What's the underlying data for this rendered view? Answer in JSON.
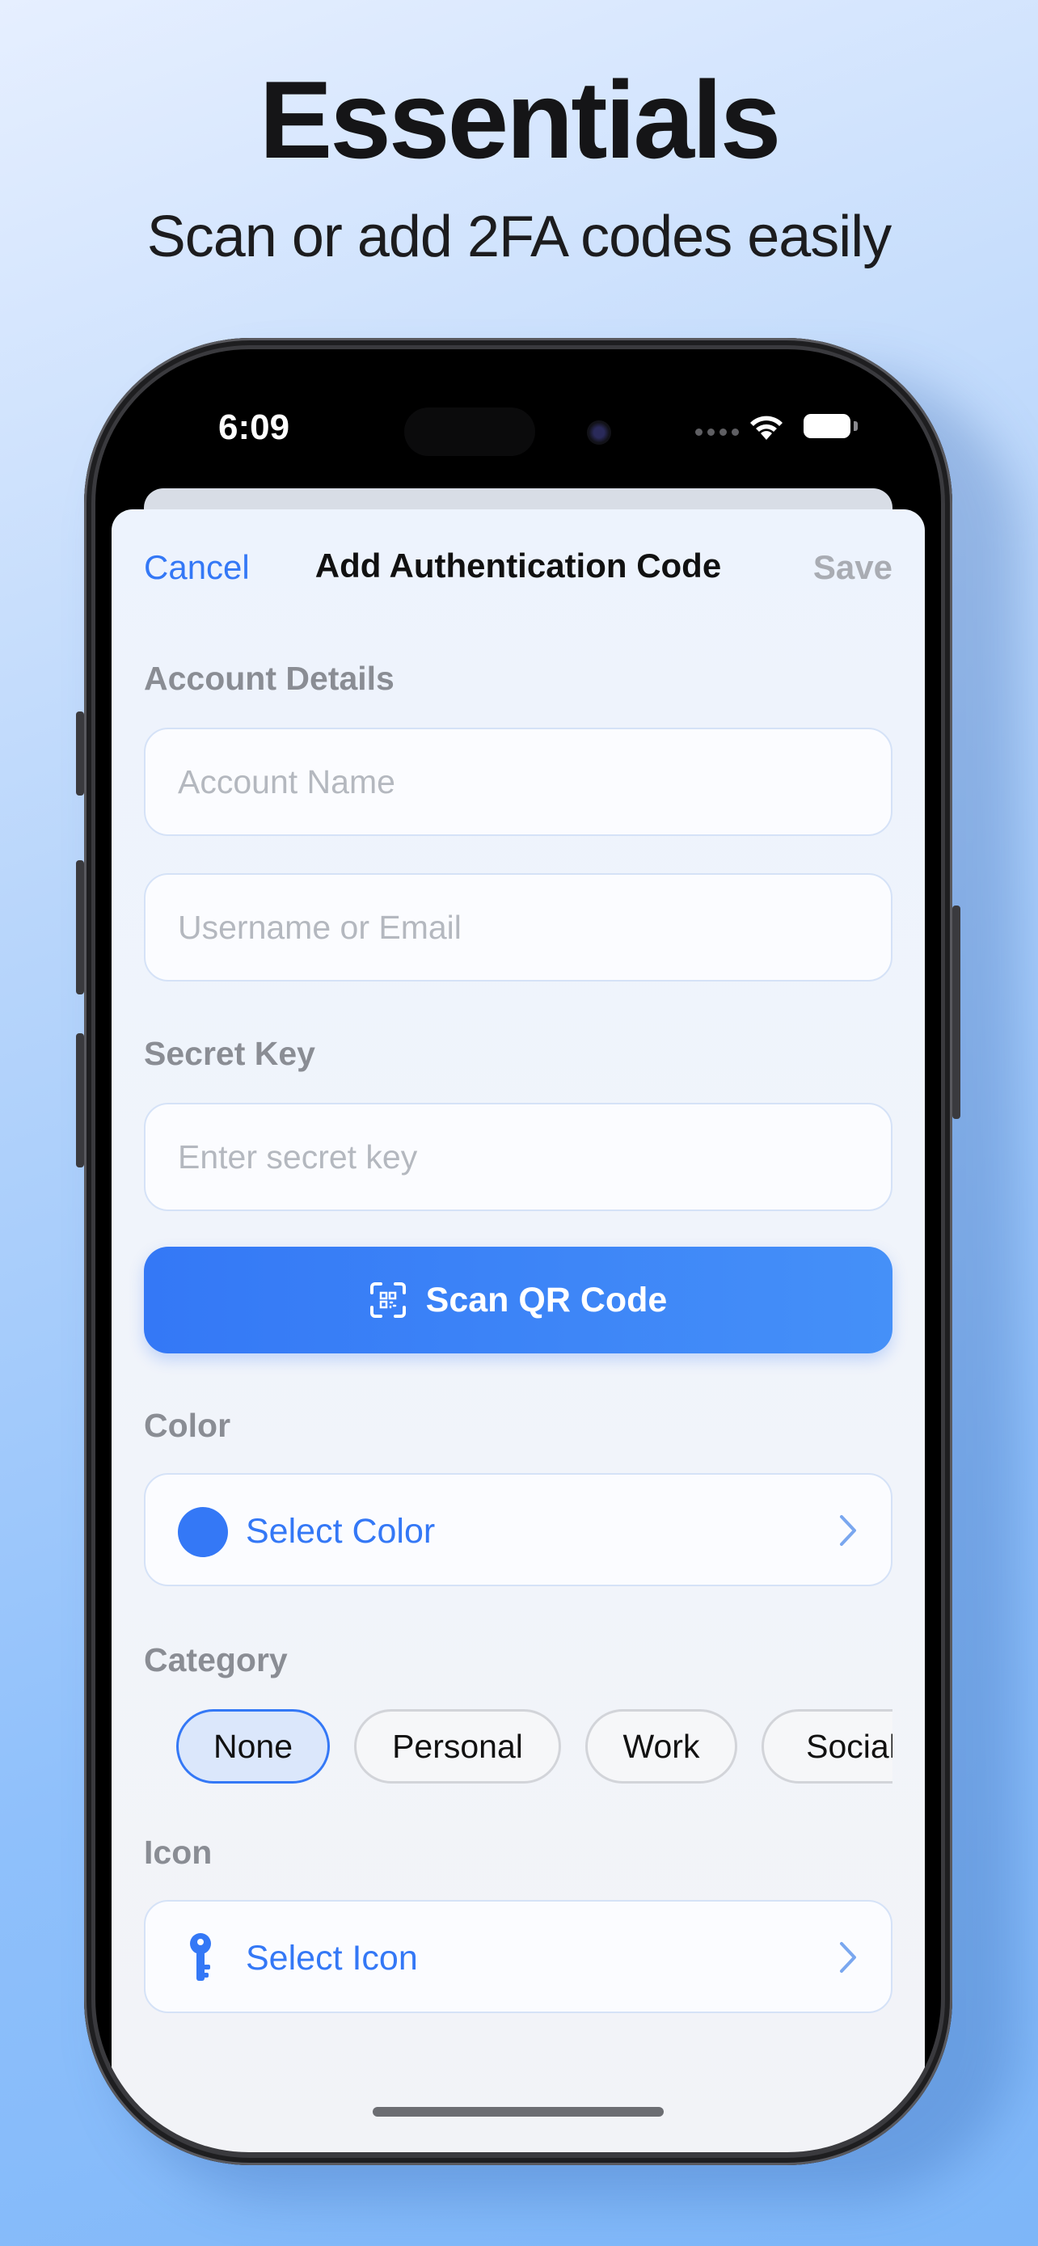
{
  "promo": {
    "headline": "Essentials",
    "subheadline": "Scan or add 2FA codes easily"
  },
  "status_bar": {
    "time": "6:09"
  },
  "nav": {
    "cancel_label": "Cancel",
    "title": "Add Authentication Code",
    "save_label": "Save"
  },
  "account_details": {
    "label": "Account Details",
    "account_name_placeholder": "Account Name",
    "username_placeholder": "Username or Email"
  },
  "secret": {
    "label": "Secret Key",
    "placeholder": "Enter secret key"
  },
  "scan_button": {
    "label": "Scan QR Code",
    "icon": "qr-scan-icon"
  },
  "color": {
    "label": "Color",
    "select_label": "Select Color",
    "current_color": "#3478F6"
  },
  "category": {
    "label": "Category",
    "options": [
      "None",
      "Personal",
      "Work",
      "Social"
    ],
    "selected": "None"
  },
  "icon_section": {
    "label": "Icon",
    "select_label": "Select Icon",
    "current_icon": "key-icon"
  },
  "theme": {
    "accent": "#3478F6",
    "disabled": "#A9ACB3"
  }
}
